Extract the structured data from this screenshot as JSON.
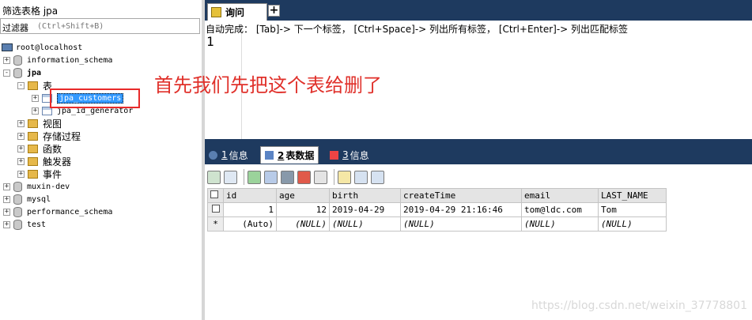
{
  "filter": {
    "title": "筛选表格 jpa",
    "label": "过滤器",
    "placeholder": "(Ctrl+Shift+B)"
  },
  "tree": {
    "root": "root@localhost",
    "items": [
      {
        "label": "information_schema",
        "expander": "+"
      },
      {
        "label": "jpa",
        "expander": "-"
      },
      {
        "label": "表",
        "expander": "-"
      },
      {
        "label": "jpa_customers",
        "expander": "+"
      },
      {
        "label": "jpa_id_generator",
        "expander": "+"
      },
      {
        "label": "视图",
        "expander": "+"
      },
      {
        "label": "存储过程",
        "expander": "+"
      },
      {
        "label": "函数",
        "expander": "+"
      },
      {
        "label": "触发器",
        "expander": "+"
      },
      {
        "label": "事件",
        "expander": "+"
      },
      {
        "label": "muxin-dev",
        "expander": "+"
      },
      {
        "label": "mysql",
        "expander": "+"
      },
      {
        "label": "performance_schema",
        "expander": "+"
      },
      {
        "label": "test",
        "expander": "+"
      }
    ]
  },
  "query_tab": {
    "label": "询问",
    "new_tab": "+"
  },
  "editor": {
    "hint": "自动完成： [Tab]-> 下一个标签， [Ctrl+Space]-> 列出所有标签， [Ctrl+Enter]-> 列出匹配标签",
    "line_number": "1"
  },
  "annotation": "首先我们先把这个表给删了",
  "result_tabs": [
    {
      "num": "1",
      "label": "信息"
    },
    {
      "num": "2",
      "label": "表数据"
    },
    {
      "num": "3",
      "label": "信息"
    }
  ],
  "table": {
    "columns": [
      "id",
      "age",
      "birth",
      "createTime",
      "email",
      "LAST_NAME"
    ],
    "rows": [
      {
        "marker": "",
        "id": "1",
        "age": "12",
        "birth": "2019-04-29",
        "createTime": "2019-04-29 21:16:46",
        "email": "tom@ldc.com",
        "last_name": "Tom"
      },
      {
        "marker": "*",
        "id": "(Auto)",
        "age": "(NULL)",
        "birth": "(NULL)",
        "createTime": "(NULL)",
        "email": "(NULL)",
        "last_name": "(NULL)"
      }
    ]
  },
  "watermark": "https://blog.csdn.net/weixin_37778801",
  "colors": {
    "dark_bg": "#1e3a5f",
    "annotation": "#e0302a",
    "selection": "#3399ff",
    "highlight_box": "#e82a2a"
  }
}
